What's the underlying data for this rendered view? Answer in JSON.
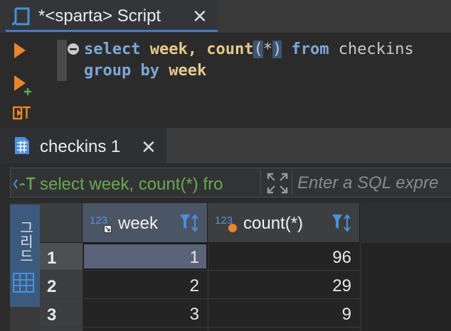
{
  "editor_tab": {
    "title": "*<sparta> Script"
  },
  "code": {
    "line1": {
      "select": "select",
      "week": "week,",
      "count": "count",
      "open_paren": "(",
      "star": "*",
      "close_paren": ")",
      "from": "from",
      "table": "checkins"
    },
    "line2": {
      "group": "group",
      "by": "by",
      "week": "week"
    }
  },
  "results_tab": {
    "title": "checkins 1"
  },
  "filter": {
    "query_preview": "select week, count(*) fro",
    "placeholder": "Enter a SQL expre"
  },
  "sidebar": {
    "label": "그리드"
  },
  "table": {
    "columns": [
      {
        "type_badge": "123",
        "name": "week"
      },
      {
        "type_badge": "123",
        "name": "count(*)"
      }
    ],
    "rows": [
      {
        "num": "1",
        "week": "1",
        "count": "96"
      },
      {
        "num": "2",
        "week": "2",
        "count": "29"
      },
      {
        "num": "3",
        "week": "3",
        "count": "9"
      }
    ]
  },
  "colors": {
    "accent": "#4a78c2",
    "keyword": "#7da7d9",
    "identifier": "#e6c98a",
    "run_orange": "#e8862a",
    "filter_green": "#6aa84f",
    "selected_cell": "#5a6478"
  },
  "icons": [
    "script-icon",
    "run-statement-icon",
    "run-new-tab-icon",
    "explain-plan-icon",
    "collapse-icon",
    "table-grid-icon",
    "close-icon",
    "filter-icon",
    "sort-icon",
    "key-icon",
    "expand-icon"
  ]
}
